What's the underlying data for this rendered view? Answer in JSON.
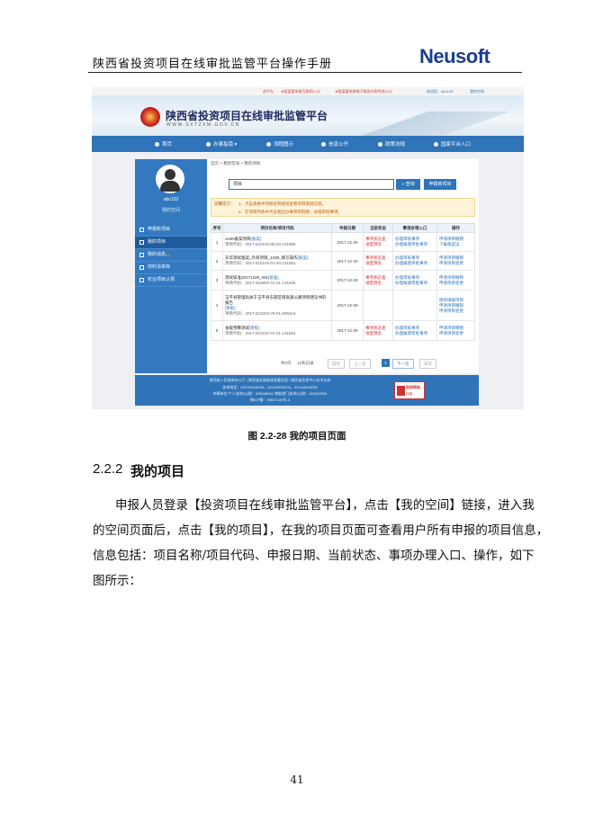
{
  "header": {
    "title": "陕西省投资项目在线审批监管平台操作手册",
    "logo": "Neusoft"
  },
  "screenshot": {
    "topbar": {
      "links": [
        "进平台",
        "★智监管系统互联网入口",
        "★智监管系统电子政务外网专线入口"
      ],
      "user": "欢迎您，abc123",
      "actions": "我的空间"
    },
    "site_title": "陕西省投资项目在线审批监管平台",
    "site_url": "WWW.SXTZXM.GOV.CN",
    "nav": [
      "首页",
      "办事指南",
      "流程图示",
      "信息公开",
      "政策法规",
      "国家平台入口"
    ],
    "user": {
      "name": "abc123",
      "space": "我的空间"
    },
    "side_menu": [
      {
        "label": "申报新项目",
        "badge": ""
      },
      {
        "label": "我的项目",
        "badge": ""
      },
      {
        "label": "我的消息",
        "badge": "99"
      },
      {
        "label": "材料清单库",
        "badge": ""
      },
      {
        "label": "农业项目认领",
        "badge": ""
      }
    ],
    "breadcrumb": "首页 > 我的空间 > 我的项目",
    "search": {
      "value": "项目",
      "query_btn": "查询",
      "new_btn": "申报新项目"
    },
    "tips": {
      "label": "温馨提示：",
      "line1": "1、点击表格中项目名称链接查看项目基础信息。",
      "line2": "2、在项目列表中点击相应办事项目链接，办理审批事项。"
    },
    "table": {
      "headers": [
        "序号",
        "项目名称/项目代码",
        "申报日期",
        "当前状态",
        "事项办理入口",
        "操作"
      ],
      "rows": [
        {
          "no": "1",
          "name": "ceshi备案项目",
          "tag": "[备案]",
          "code": "项目代码：2017-610102-06-03-131855",
          "date": "2017-12-30",
          "status": [
            "事项状态查",
            "进度预览"
          ],
          "entry": [
            "办理审核事项",
            "办理报建审批事项"
          ],
          "ops": [
            "申请项目撤销",
            "下载备案证"
          ]
        },
        {
          "no": "2",
          "name": "东华测试备案_外商项目_1239_填写操作",
          "tag": "[备案]",
          "code": "项目代码：2017-610102-01-03-131851",
          "date": "2017-12-30",
          "status": [
            "事项状态查",
            "进度预览"
          ],
          "entry": [
            "办理审核事项",
            "办理报建审批事项"
          ],
          "ops": [
            "申请项目撤销",
            "申请项目变更"
          ]
        },
        {
          "no": "3",
          "name": "测试核准20171229_001",
          "tag": "[核准]",
          "code": "项目代码：2017-610802-01-01-131835",
          "date": "2017-12-29",
          "status": [
            "事项状态查",
            "进度预览"
          ],
          "entry": [
            "办理审核事项",
            "办理报建审批事项"
          ],
          "ops": [
            "申请项目撤销",
            "申请项目变更"
          ]
        },
        {
          "no": "4",
          "name": "玉平县管理局关于玉平县东部区域高速公路项目建议书的报告",
          "tag": "[审批]",
          "code": "项目代码：2017-610203-78-01-000416",
          "date": "2017-12-29",
          "status": [
            "",
            ""
          ],
          "entry": [
            "",
            ""
          ],
          "ops": [
            "继续填报项目",
            "申请项目撤销",
            "申请项目变更"
          ]
        },
        {
          "no": "5",
          "name": "省级预算测试",
          "tag": "[审批]",
          "code": "项目代码：2017-610102-01-01-131831",
          "date": "2017-12-29",
          "status": [
            "事项状态查",
            "进度预览"
          ],
          "entry": [
            "办理审核事项",
            "办理报建审批事项"
          ],
          "ops": [
            "申请项目撤销",
            "申请项目变更"
          ]
        }
      ]
    },
    "pager": {
      "total": "共3页",
      "records": "13条记录",
      "first": "首页",
      "prev": "上一页",
      "current": "1",
      "next": "下一页",
      "last": "末页"
    },
    "footer": {
      "line1": "陕西省人民政府办公厅 | 陕西省发展和改革委员会 | 陕西省信息中心技术支持",
      "line2": "咨询电话：029-63918236，029-63918203，029-63918205",
      "line3": "申报单位/个人咨询QQ群：535348941    审批部门咨询QQ群：424282505",
      "line4": "陕ICP备：05007139号-3",
      "badge1": "政府网站",
      "badge2": "找错"
    }
  },
  "caption": "图 2.2-28  我的项目页面",
  "section": {
    "number": "2.2.2",
    "title": "我的项目"
  },
  "paragraph": [
    "申报人员登录【投资项目在线审批监管平台】，点击【我的空间】链接，进入我",
    "的空间页面后，点击【我的项目】，在我的项目页面可查看用户所有申报的项目信息，",
    "信息包括：项目名称/项目代码、申报日期、当前状态、事项办理入口、操作，如下",
    "图所示："
  ],
  "page_number": "41"
}
